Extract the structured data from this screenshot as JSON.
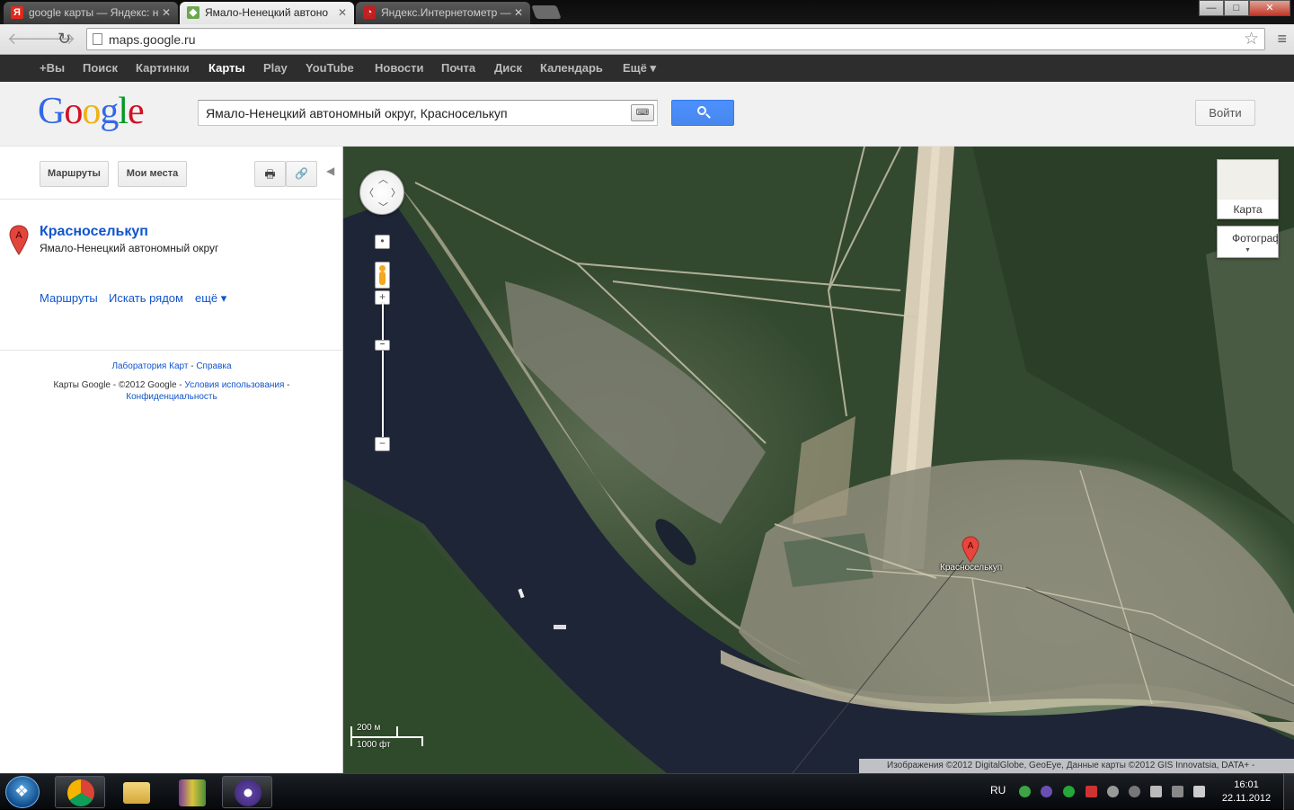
{
  "browser": {
    "tabs": [
      {
        "title": "google карты — Яндекс: н",
        "favicon": "yandex-icon",
        "active": false
      },
      {
        "title": "Ямало-Ненецкий автоно",
        "favicon": "google-maps-icon",
        "active": true
      },
      {
        "title": "Яндекс.Интернетометр —",
        "favicon": "yandex-internetometer-icon",
        "active": false
      }
    ],
    "tab_close": "✕",
    "url": "maps.google.ru",
    "window_controls": {
      "minimize": "—",
      "maximize": "□",
      "close": "✕"
    }
  },
  "gbar": {
    "items": [
      "+Вы",
      "Поиск",
      "Картинки",
      "Карты",
      "Play",
      "YouTube",
      "Новости",
      "Почта",
      "Диск",
      "Календарь",
      "Ещё ▾"
    ],
    "selected": "Карты"
  },
  "header": {
    "logo": [
      "G",
      "o",
      "o",
      "g",
      "l",
      "e"
    ],
    "logo_colors": [
      "#3369e8",
      "#d50f25",
      "#eeb211",
      "#3369e8",
      "#009925",
      "#d50f25"
    ],
    "search_query": "Ямало-Ненецкий автономный округ, Красноселькуп",
    "keyboard_icon": "⌨",
    "signin_label": "Войти"
  },
  "panel": {
    "routes_button": "Маршруты",
    "my_places_button": "Мои места",
    "print_icon": "🖶",
    "link_icon": "🔗",
    "result": {
      "marker": "A",
      "name": "Красноселькуп",
      "region": "Ямало-Ненецкий автономный округ",
      "links": [
        "Маршруты",
        "Искать рядом",
        "ещё ▾"
      ]
    },
    "footer": {
      "labs": "Лаборатория Карт",
      "sep": " - ",
      "help": "Справка",
      "copyright": "Карты Google - ©2012 Google - ",
      "terms": "Условия использования",
      "sep2": " -",
      "privacy": "Конфиденциальность"
    }
  },
  "map": {
    "maptype_map": "Карта",
    "maptype_photo": "Фотографии",
    "pin_letter": "A",
    "pin_label": "Красноселькуп",
    "scale_metric": "200 м",
    "scale_imperial": "1000 фт",
    "attribution": "Изображения ©2012 DigitalGlobe, GeoEye, Данные карты ©2012 GIS Innovatsia, DATA+ -",
    "river_color": "#1e2536",
    "forest_color": "#33492f"
  },
  "taskbar": {
    "apps": [
      "chrome-icon",
      "explorer-folder-icon",
      "winrar-icon",
      "bittorrent-icon"
    ],
    "language": "RU",
    "time": "16:01",
    "date": "22.11.2012"
  }
}
